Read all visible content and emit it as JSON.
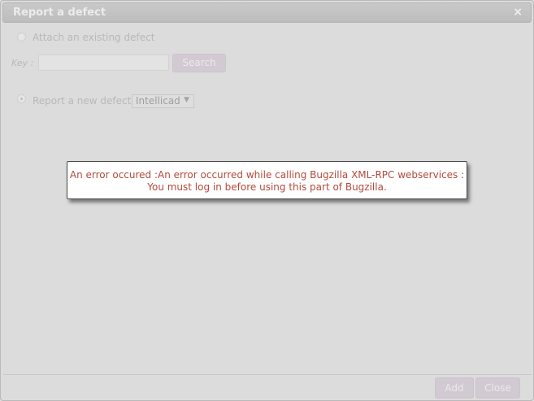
{
  "dialog": {
    "title": "Report a defect",
    "close_glyph": "×"
  },
  "attach_existing": {
    "label": "Attach an existing defect",
    "selected": false,
    "key_label": "Key :",
    "key_value": "",
    "search_label": "Search"
  },
  "report_new": {
    "label": "Report a new defect",
    "selected": true,
    "project_value": "Intellicad",
    "dropdown_glyph": "▼"
  },
  "error": {
    "line1": "An error occured :An error occurred while calling Bugzilla XML-RPC webservices :",
    "line2": "You must log in before using this part of Bugzilla.",
    "color": "#b24a3c"
  },
  "footer": {
    "add_label": "Add",
    "close_label": "Close"
  }
}
